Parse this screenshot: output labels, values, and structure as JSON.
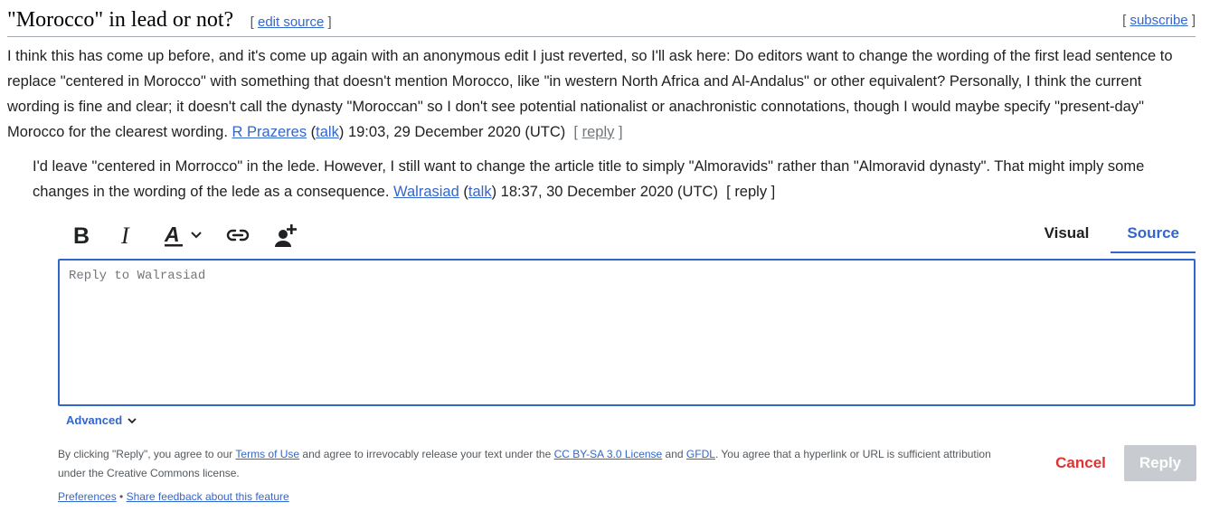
{
  "section": {
    "title": "\"Morocco\" in lead or not?",
    "edit_open": "[",
    "edit_label": "edit source",
    "edit_close": "]",
    "subscribe_open": "[",
    "subscribe_label": "subscribe",
    "subscribe_close": "]"
  },
  "comments": [
    {
      "text": "I think this has come up before, and it's come up again with an anonymous edit I just reverted, so I'll ask here: Do editors want to change the wording of the first lead sentence to replace \"centered in Morocco\" with something that doesn't mention Morocco, like \"in western North Africa and Al-Andalus\" or other equivalent? Personally, I think the current wording is fine and clear; it doesn't call the dynasty \"Moroccan\" so I don't see potential nationalist or anachronistic connotations, though I would maybe specify \"present-day\" Morocco for the clearest wording.",
      "user": "R Prazeres",
      "talk_open": "(",
      "talk": "talk",
      "talk_close": ")",
      "timestamp": "19:03, 29 December 2020 (UTC)",
      "reply_open": "[",
      "reply": "reply",
      "reply_close": "]"
    },
    {
      "text": "I'd leave \"centered in Morrocco\" in the lede. However, I still want to change the article title to simply \"Almoravids\" rather than \"Almoravid dynasty\". That might imply some changes in the wording of the lede as a consequence.",
      "user": "Walrasiad",
      "talk_open": "(",
      "talk": "talk",
      "talk_close": ")",
      "timestamp": "18:37, 30 December 2020 (UTC)",
      "reply_open": "[",
      "reply": "reply",
      "reply_close": "]"
    }
  ],
  "reply_widget": {
    "toolbar": {
      "icons": [
        "bold-icon",
        "italic-icon",
        "text-style-icon",
        "chevron-down-icon",
        "link-icon",
        "mention-user-icon"
      ]
    },
    "tabs": {
      "visual": "Visual",
      "source": "Source",
      "active": "Source"
    },
    "placeholder": "Reply to Walrasiad",
    "value": "",
    "advanced": "Advanced",
    "legal": {
      "p1": "By clicking \"Reply\", you agree to our ",
      "terms": "Terms of Use",
      "p2": " and agree to irrevocably release your text under the ",
      "license": "CC BY-SA 3.0 License",
      "p3": " and ",
      "gfdl": "GFDL",
      "p4": ". You agree that a hyperlink or URL is sufficient attribution under the Creative Commons license."
    },
    "footer": {
      "preferences": "Preferences",
      "separator": " • ",
      "feedback": "Share feedback about this feature"
    },
    "cancel": "Cancel",
    "reply": "Reply"
  },
  "colors": {
    "link": "#3366cc",
    "cancel": "#dd3333",
    "reply_disabled_bg": "#c8ccd1",
    "editor_border": "#3366cc"
  }
}
